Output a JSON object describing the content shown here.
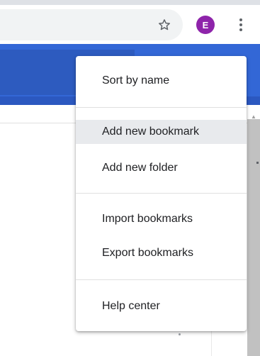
{
  "toolbar": {
    "star_icon": "star-outline-icon",
    "avatar_letter": "E",
    "avatar_color": "#8e24aa",
    "menu_icon": "more-vert-icon"
  },
  "theme": {
    "header_color": "#3367d6",
    "hover_color": "#e8eaed"
  },
  "menu": {
    "sort_by_name": "Sort by name",
    "add_new_bookmark": "Add new bookmark",
    "add_new_folder": "Add new folder",
    "import_bookmarks": "Import bookmarks",
    "export_bookmarks": "Export bookmarks",
    "help_center": "Help center",
    "hovered_item": "Add new bookmark"
  }
}
